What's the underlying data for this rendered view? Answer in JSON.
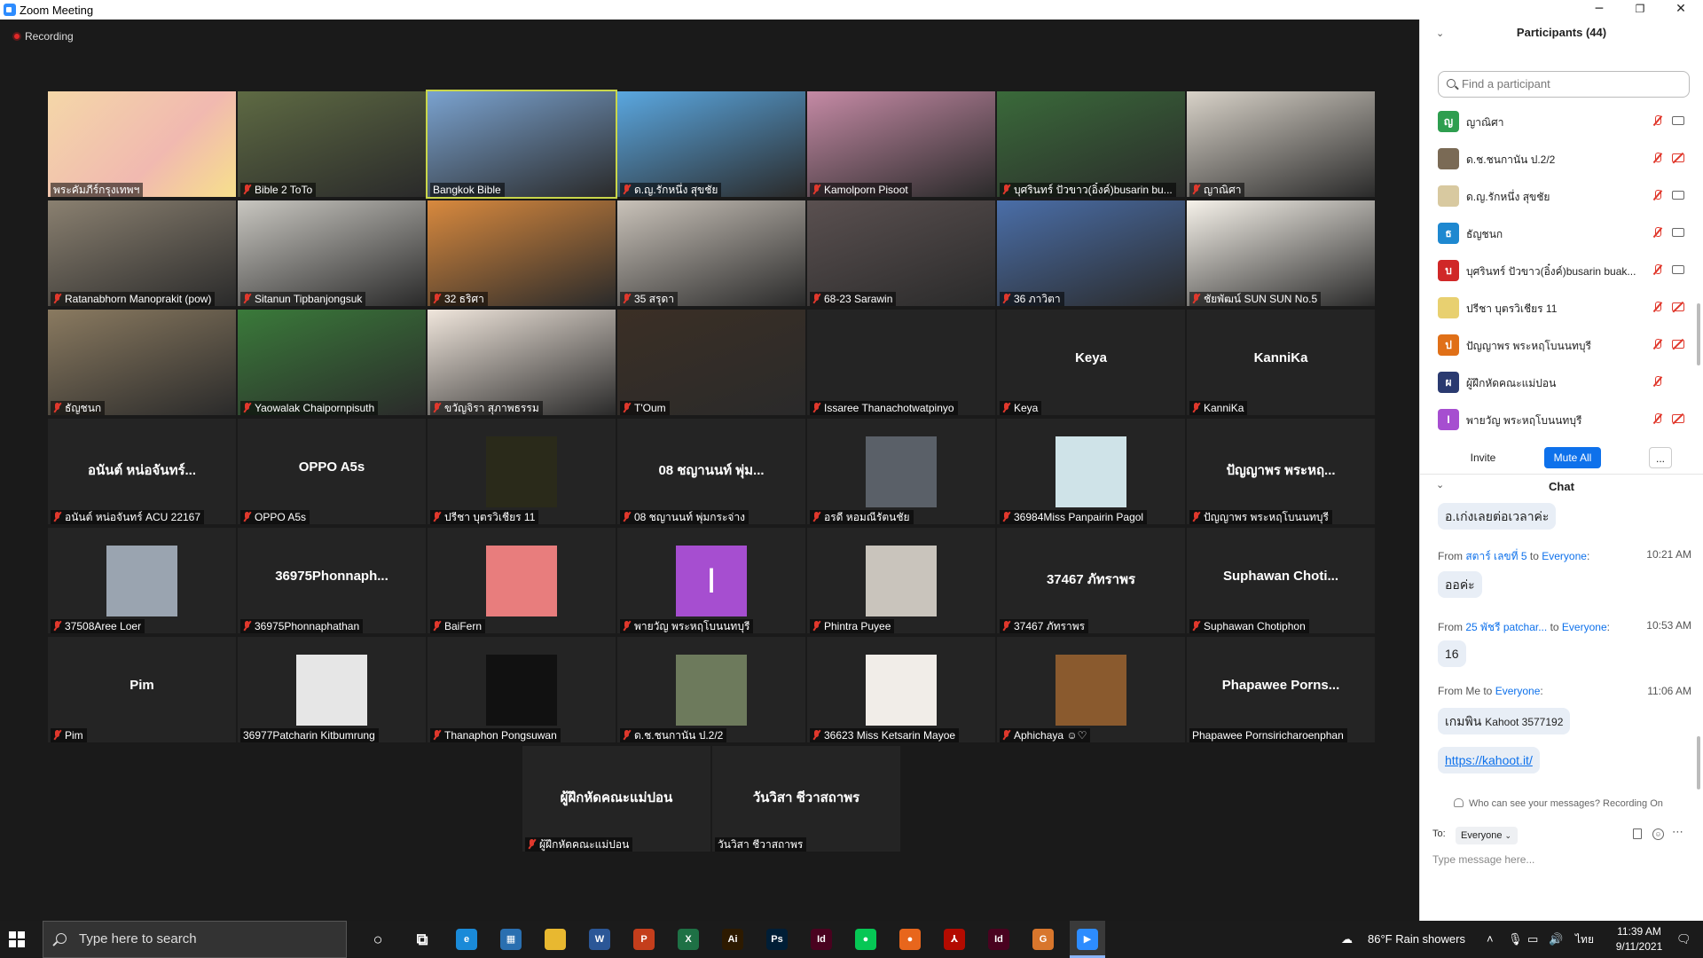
{
  "window": {
    "title": "Zoom Meeting",
    "minimize": "─",
    "restore": "❐",
    "close": "✕"
  },
  "recording": "Recording",
  "gallery": {
    "tiles": [
      {
        "label": "พระคัมภีร์กรุงเทพฯ",
        "muted": false,
        "kind": "poster"
      },
      {
        "label": "Bible 2 ToTo",
        "muted": true,
        "kind": "video"
      },
      {
        "label": "Bangkok Bible",
        "muted": false,
        "kind": "video",
        "active": true
      },
      {
        "label": "ด.ญ.รักหนึ่ง สุขชัย",
        "muted": true,
        "kind": "video"
      },
      {
        "label": "Kamolporn Pisoot",
        "muted": true,
        "kind": "video"
      },
      {
        "label": "บุศรินทร์ ปัวขาว(อิ๋งค์)busarin bu...",
        "muted": true,
        "kind": "video"
      },
      {
        "label": "ญาณิศา",
        "muted": true,
        "kind": "video"
      },
      {
        "label": "Ratanabhorn Manoprakit (pow)",
        "muted": true,
        "kind": "video"
      },
      {
        "label": "Sitanun Tipbanjongsuk",
        "muted": true,
        "kind": "video"
      },
      {
        "label": "32 ธริศา",
        "muted": true,
        "kind": "video"
      },
      {
        "label": "35 สรุดา",
        "muted": true,
        "kind": "video"
      },
      {
        "label": "68-23 Sarawin",
        "muted": true,
        "kind": "video"
      },
      {
        "label": "36 ภาวิตา",
        "muted": true,
        "kind": "video"
      },
      {
        "label": "ชัยพัฒน์ SUN SUN No.5",
        "muted": true,
        "kind": "video"
      },
      {
        "label": "ธัญชนก",
        "muted": true,
        "kind": "video"
      },
      {
        "label": "Yaowalak Chaipornpisuth",
        "muted": true,
        "kind": "video"
      },
      {
        "label": "ขวัญจิรา สุภาพธรรม",
        "muted": true,
        "kind": "video"
      },
      {
        "label": "T'Oum",
        "muted": true,
        "kind": "video"
      },
      {
        "label": "Issaree Thanachotwatpinyo",
        "muted": true,
        "kind": "blank"
      },
      {
        "label": "Keya",
        "muted": true,
        "kind": "name",
        "center": "Keya"
      },
      {
        "label": "KanniKa",
        "muted": true,
        "kind": "name",
        "center": "KanniKa"
      },
      {
        "label": "อนันต์ หน่อจันทร์ ACU 22167",
        "muted": true,
        "kind": "name",
        "center": "อนันต์ หน่อจันทร์..."
      },
      {
        "label": "OPPO A5s",
        "muted": true,
        "kind": "name",
        "center": "OPPO A5s"
      },
      {
        "label": "ปรีชา บุตรวิเชียร  11",
        "muted": true,
        "kind": "pic",
        "pic": "#2a2a1a"
      },
      {
        "label": "08 ชญานนท์ พุ่มกระจ่าง",
        "muted": true,
        "kind": "name",
        "center": "08 ชญานนท์ พุ่ม..."
      },
      {
        "label": "อรดี หอมณีรัตนชัย",
        "muted": true,
        "kind": "pic",
        "pic": "#5a6068"
      },
      {
        "label": "36984Miss Panpairin Pagol",
        "muted": true,
        "kind": "pic",
        "pic": "#cfe3e8"
      },
      {
        "label": "ปัญญาพร พระหฤโบนนทบุรี",
        "muted": true,
        "kind": "name",
        "center": "ปัญญาพร พระหฤ..."
      },
      {
        "label": "37508Aree Loer",
        "muted": true,
        "kind": "pic",
        "pic": "#9aa4b0"
      },
      {
        "label": "36975Phonnaphathan",
        "muted": true,
        "kind": "name",
        "center": "36975Phonnaph..."
      },
      {
        "label": "BaiFern",
        "muted": true,
        "kind": "pic",
        "pic": "#e87d7d"
      },
      {
        "label": "พายวัญ พระหฤโบนนทบุรี",
        "muted": true,
        "kind": "letter",
        "pic": "#a64ed0",
        "letter": "I"
      },
      {
        "label": "Phintra Puyee",
        "muted": true,
        "kind": "pic",
        "pic": "#c9c4bc"
      },
      {
        "label": "37467 ภัทราพร",
        "muted": true,
        "kind": "name",
        "center": "37467 ภัทราพร"
      },
      {
        "label": "Suphawan Chotiphon",
        "muted": true,
        "kind": "name",
        "center": "Suphawan  Choti..."
      },
      {
        "label": "Pim",
        "muted": true,
        "kind": "name",
        "center": "Pim"
      },
      {
        "label": "36977Patcharin Kitbumrung",
        "muted": false,
        "kind": "pic",
        "pic": "#e6e6e6"
      },
      {
        "label": "Thanaphon Pongsuwan",
        "muted": true,
        "kind": "pic",
        "pic": "#111111"
      },
      {
        "label": "ด.ช.ชนกานัน ป.2/2",
        "muted": true,
        "kind": "pic",
        "pic": "#6d7a5c"
      },
      {
        "label": "36623 Miss Ketsarin Mayoe",
        "muted": true,
        "kind": "pic",
        "pic": "#f1ede8"
      },
      {
        "label": "Aphichaya ☺♡",
        "muted": true,
        "kind": "pic",
        "pic": "#8a5a2e"
      },
      {
        "label": "Phapawee Pornsiricharoenphan",
        "muted": false,
        "kind": "name",
        "center": "Phapawee  Porns..."
      },
      {
        "label": "ผู้ฝึกหัดคณะแม่ปอน",
        "muted": true,
        "kind": "name",
        "center": "ผู้ฝึกหัดคณะแม่ปอน"
      },
      {
        "label": "วันวิสา ชีวาสถาพร",
        "muted": false,
        "kind": "name",
        "center": "วันวิสา ชีวาสถาพร"
      }
    ]
  },
  "participants": {
    "title": "Participants (44)",
    "search_placeholder": "Find a participant",
    "items": [
      {
        "name": "ญาณิศา",
        "avatar": "ญ",
        "color": "#2e9e4f",
        "cam_off": false
      },
      {
        "name": "ด.ช.ชนกานัน ป.2/2",
        "avatar": "",
        "color": "#7a6a55",
        "cam_off": true
      },
      {
        "name": "ด.ญ.รักหนึ่ง สุขชัย",
        "avatar": "",
        "color": "#d8c9a0",
        "cam_off": false
      },
      {
        "name": "ธัญชนก",
        "avatar": "ธ",
        "color": "#1e88d0",
        "cam_off": false
      },
      {
        "name": "บุศรินทร์ ปัวขาว(อิ๋งค์)busarin buak...",
        "avatar": "บ",
        "color": "#d02828",
        "cam_off": false
      },
      {
        "name": "ปรีชา บุตรวิเชียร  11",
        "avatar": "",
        "color": "#e8d070",
        "cam_off": true
      },
      {
        "name": "ปัญญาพร พระหฤโบนนทบุรี",
        "avatar": "ป",
        "color": "#e07018",
        "cam_off": true
      },
      {
        "name": "ผู้ฝึกหัดคณะแม่ปอน",
        "avatar": "ผ",
        "color": "#2a3a70",
        "cam_off": null
      },
      {
        "name": "พายวัญ พระหฤโบนนทบุรี",
        "avatar": "I",
        "color": "#a64ed0",
        "cam_off": true
      }
    ],
    "invite": "Invite",
    "mute_all": "Mute All",
    "more": "..."
  },
  "chat": {
    "title": "Chat",
    "messages": [
      {
        "kind": "bubble",
        "text": "อ.เก่งเลยต่อเวลาค่ะ"
      },
      {
        "kind": "header",
        "from": "From ",
        "who": "สตาร์ เลขที่ 5",
        "to": " to ",
        "to_who": "Everyone",
        "colon": ":",
        "time": "10:21 AM"
      },
      {
        "kind": "bubble",
        "text": "ออค่ะ"
      },
      {
        "kind": "header",
        "from": "From ",
        "who": "25 พัชรี patchar...",
        "to": " to ",
        "to_who": "Everyone",
        "colon": ":",
        "time": "10:53 AM"
      },
      {
        "kind": "bubble",
        "text": "16"
      },
      {
        "kind": "header",
        "from": "From Me to ",
        "who": "",
        "to": "",
        "to_who": "Everyone",
        "colon": ":",
        "time": "11:06 AM"
      },
      {
        "kind": "bubble",
        "text": "เกมพิน",
        "small": "Kahoot 3577192"
      },
      {
        "kind": "link",
        "text": "https://kahoot.it/"
      }
    ],
    "notice": "Who can see your messages? Recording On",
    "to_label": "To:",
    "to_value": "Everyone",
    "input_placeholder": "Type message here..."
  },
  "taskbar": {
    "search_placeholder": "Type here to search",
    "apps": [
      {
        "name": "cortana",
        "glyph": "○",
        "color": "transparent"
      },
      {
        "name": "task-view",
        "glyph": "⧉",
        "color": "transparent"
      },
      {
        "name": "edge",
        "glyph": "e",
        "color": "#1a8ad8"
      },
      {
        "name": "calculator",
        "glyph": "▦",
        "color": "#2a6fb0"
      },
      {
        "name": "file-explorer",
        "glyph": "",
        "color": "#e8b830"
      },
      {
        "name": "word",
        "glyph": "W",
        "color": "#2b5797"
      },
      {
        "name": "powerpoint",
        "glyph": "P",
        "color": "#c43e1c"
      },
      {
        "name": "excel",
        "glyph": "X",
        "color": "#1e7145"
      },
      {
        "name": "illustrator",
        "glyph": "Ai",
        "color": "#2d1a00"
      },
      {
        "name": "photoshop",
        "glyph": "Ps",
        "color": "#001e36"
      },
      {
        "name": "indesign",
        "glyph": "Id",
        "color": "#49021f"
      },
      {
        "name": "line",
        "glyph": "●",
        "color": "#06c755"
      },
      {
        "name": "firefox",
        "glyph": "●",
        "color": "#e8661c"
      },
      {
        "name": "acrobat",
        "glyph": "⅄",
        "color": "#b30b00"
      },
      {
        "name": "indesign-2",
        "glyph": "Id",
        "color": "#49021f"
      },
      {
        "name": "grammarly",
        "glyph": "G",
        "color": "#d8762c"
      },
      {
        "name": "zoom",
        "glyph": "▶",
        "color": "#2d8cff"
      }
    ],
    "weather": "86°F  Rain showers",
    "lang": "ไทย",
    "time": "11:39 AM",
    "date": "9/11/2021"
  }
}
